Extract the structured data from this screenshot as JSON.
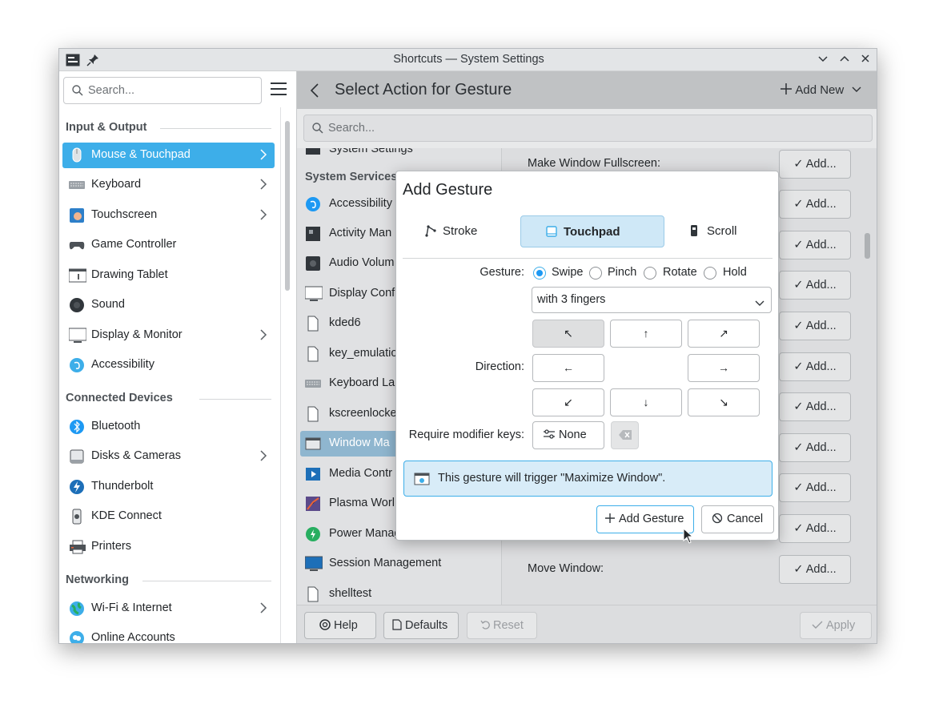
{
  "window": {
    "title": "Shortcuts — System Settings"
  },
  "sidebar": {
    "search_placeholder": "Search...",
    "categories": {
      "input_output": "Input & Output",
      "connected_devices": "Connected Devices",
      "networking": "Networking"
    },
    "items": [
      {
        "label": "Mouse & Touchpad",
        "icon": "mouse-icon",
        "selected": true,
        "chevron": true
      },
      {
        "label": "Keyboard",
        "icon": "keyboard-icon",
        "chevron": true
      },
      {
        "label": "Touchscreen",
        "icon": "touchscreen-icon",
        "chevron": true
      },
      {
        "label": "Game Controller",
        "icon": "gamepad-icon"
      },
      {
        "label": "Drawing Tablet",
        "icon": "tablet-icon"
      },
      {
        "label": "Sound",
        "icon": "speaker-icon"
      },
      {
        "label": "Display & Monitor",
        "icon": "monitor-icon",
        "chevron": true
      },
      {
        "label": "Accessibility",
        "icon": "accessibility-icon"
      },
      {
        "label": "Bluetooth",
        "icon": "bluetooth-icon"
      },
      {
        "label": "Disks & Cameras",
        "icon": "disk-icon",
        "chevron": true
      },
      {
        "label": "Thunderbolt",
        "icon": "thunderbolt-icon"
      },
      {
        "label": "KDE Connect",
        "icon": "phone-icon"
      },
      {
        "label": "Printers",
        "icon": "printer-icon"
      },
      {
        "label": "Wi-Fi & Internet",
        "icon": "globe-icon",
        "chevron": true
      },
      {
        "label": "Online Accounts",
        "icon": "cloud-icon"
      }
    ]
  },
  "header": {
    "title": "Select Action for Gesture",
    "add_new": "Add New"
  },
  "main_search": {
    "placeholder": "Search..."
  },
  "action_list": {
    "top_item": "System Settings",
    "section": "System Services",
    "items": [
      {
        "label": "Accessibility",
        "icon": "accessibility-icon"
      },
      {
        "label": "Activity Man",
        "icon": "activity-icon"
      },
      {
        "label": "Audio Volum",
        "icon": "audio-icon"
      },
      {
        "label": "Display Conf",
        "icon": "display-icon"
      },
      {
        "label": "kded6",
        "icon": "file-icon"
      },
      {
        "label": "key_emulatio",
        "icon": "file-icon"
      },
      {
        "label": "Keyboard La",
        "icon": "keyboard-icon"
      },
      {
        "label": "kscreenlocke",
        "icon": "file-icon"
      },
      {
        "label": "Window Ma",
        "icon": "window-icon",
        "selected": true
      },
      {
        "label": "Media Contr",
        "icon": "media-icon"
      },
      {
        "label": "Plasma Worl",
        "icon": "plasma-icon"
      },
      {
        "label": "Power Management",
        "icon": "power-icon"
      },
      {
        "label": "Session Management",
        "icon": "session-icon"
      },
      {
        "label": "shelltest",
        "icon": "file-icon"
      }
    ]
  },
  "right_panel": {
    "rows": [
      {
        "label": "Make Window Fullscreen:"
      },
      {
        "label": ""
      },
      {
        "label": ""
      },
      {
        "label": ""
      },
      {
        "label": ""
      },
      {
        "label": ""
      },
      {
        "label": ""
      },
      {
        "label": ""
      },
      {
        "label": ""
      },
      {
        "label": ""
      },
      {
        "label": "Move Window:"
      }
    ],
    "add_label": "Add..."
  },
  "footer": {
    "help": "Help",
    "defaults": "Defaults",
    "reset": "Reset",
    "apply": "Apply"
  },
  "dialog": {
    "title": "Add Gesture",
    "tabs": {
      "stroke": "Stroke",
      "touchpad": "Touchpad",
      "scroll": "Scroll"
    },
    "gesture_label": "Gesture:",
    "gesture_options": {
      "swipe": "Swipe",
      "pinch": "Pinch",
      "rotate": "Rotate",
      "hold": "Hold"
    },
    "fingers_value": "with 3 fingers",
    "direction_label": "Direction:",
    "directions": {
      "nw": "↖",
      "n": "↑",
      "ne": "↗",
      "w": "←",
      "e": "→",
      "sw": "↙",
      "s": "↓",
      "se": "↘"
    },
    "modifier_label": "Require modifier keys:",
    "modifier_value": "None",
    "info": "This gesture will trigger \"Maximize Window\".",
    "add_button": "Add Gesture",
    "cancel_button": "Cancel"
  },
  "colors": {
    "accent": "#3daee9",
    "selection": "#3daee9"
  }
}
